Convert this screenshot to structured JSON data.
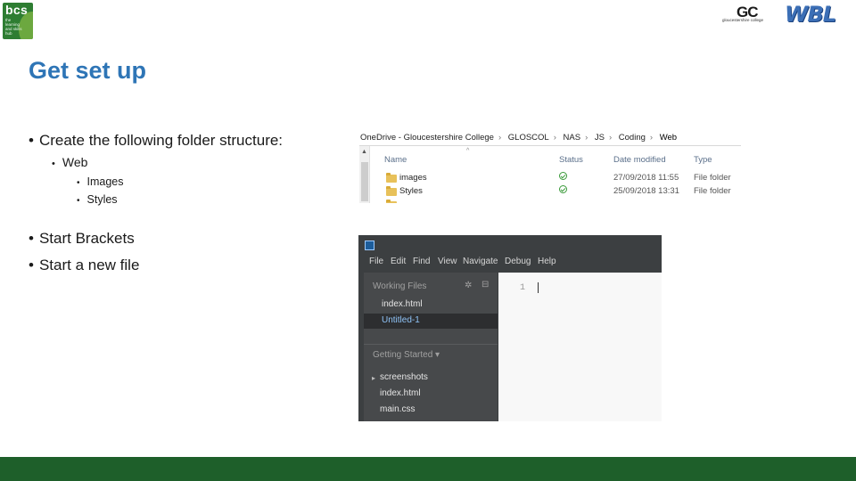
{
  "logos": {
    "bcs": {
      "word": "bcs",
      "tagline": "the learning and skills hub"
    },
    "gc": {
      "mark": "GC",
      "caption": "gloucestershire college"
    },
    "wbl": {
      "text": "WBL"
    }
  },
  "title": "Get set up",
  "bullets": {
    "folder_structure": "Create the following folder structure:",
    "web": "Web",
    "images": "Images",
    "styles": "Styles",
    "start_brackets": "Start Brackets",
    "new_file": "Start a new file"
  },
  "explorer": {
    "breadcrumb": [
      "OneDrive - Gloucestershire College",
      "GLOSCOL",
      "NAS",
      "JS",
      "Coding",
      "Web"
    ],
    "columns": {
      "name": "Name",
      "status": "Status",
      "date": "Date modified",
      "type": "Type"
    },
    "rows": [
      {
        "name": "images",
        "date": "27/09/2018 11:55",
        "type": "File folder"
      },
      {
        "name": "Styles",
        "date": "25/09/2018 13:31",
        "type": "File folder"
      }
    ]
  },
  "brackets": {
    "menu": [
      "File",
      "Edit",
      "Find",
      "View",
      "Navigate",
      "Debug",
      "Help"
    ],
    "working_files_title": "Working Files",
    "working_files": [
      "index.html",
      "Untitled-1"
    ],
    "project_title": "Getting Started",
    "project_caret": "▾",
    "project_items": [
      "screenshots",
      "index.html",
      "main.css"
    ],
    "line_number": "1"
  },
  "colors": {
    "title": "#2e75b6",
    "footer": "#1e5f2a",
    "brackets_bg": "#3c3f41",
    "selected_file": "#8fc3f7"
  }
}
